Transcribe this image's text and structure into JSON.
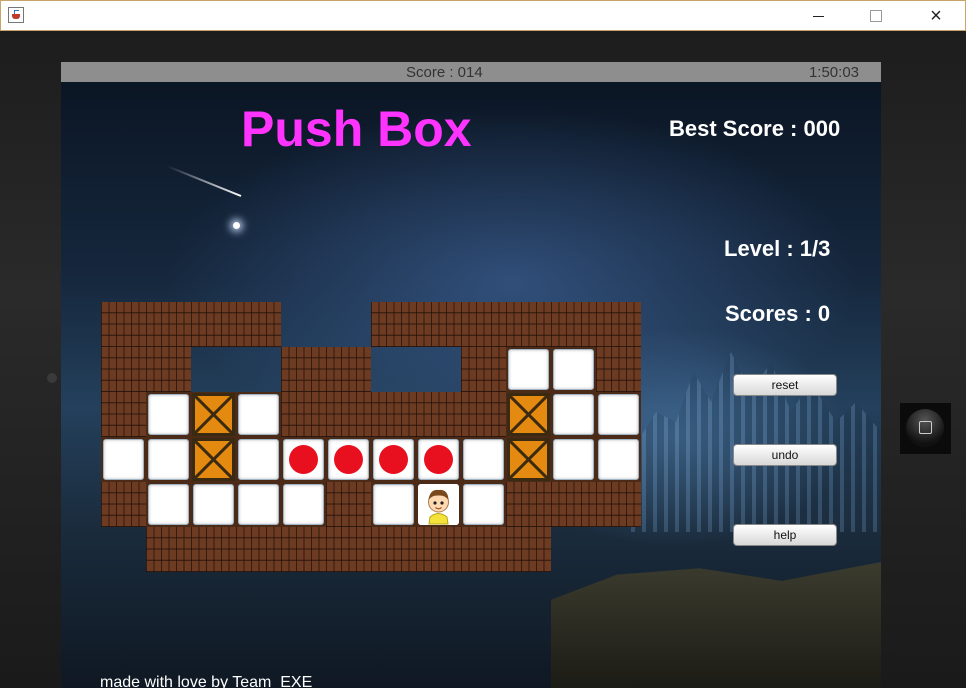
{
  "window": {
    "icon": "java-cup-icon",
    "controls": {
      "minimize": "minimize-icon",
      "maximize": "maximize-icon",
      "close": "×"
    }
  },
  "status_bar": {
    "score": "Score : 014",
    "clock": "1:50:03"
  },
  "game": {
    "title": "Push Box",
    "best_score": "Best Score : 000",
    "level": "Level : 1/3",
    "scores": "Scores : 0",
    "buttons": {
      "reset": "reset",
      "undo": "undo",
      "help": "help"
    },
    "footer": "made with love by Team_EXE"
  },
  "colors": {
    "title": "#ff33ff",
    "box": "#e58a10",
    "goal": "#e8101e",
    "status_bar": "#8e8e8e"
  },
  "board": {
    "legend": {
      "#": "wall",
      " ": "floor",
      "-": "empty",
      "B": "box",
      "G": "goal",
      "P": "player"
    },
    "rows": [
      "####--######",
      "##--##--#  #",
      "# B #####B  ",
      "  B GGGG B  ",
      "#    # P ###",
      "-#########--"
    ]
  }
}
